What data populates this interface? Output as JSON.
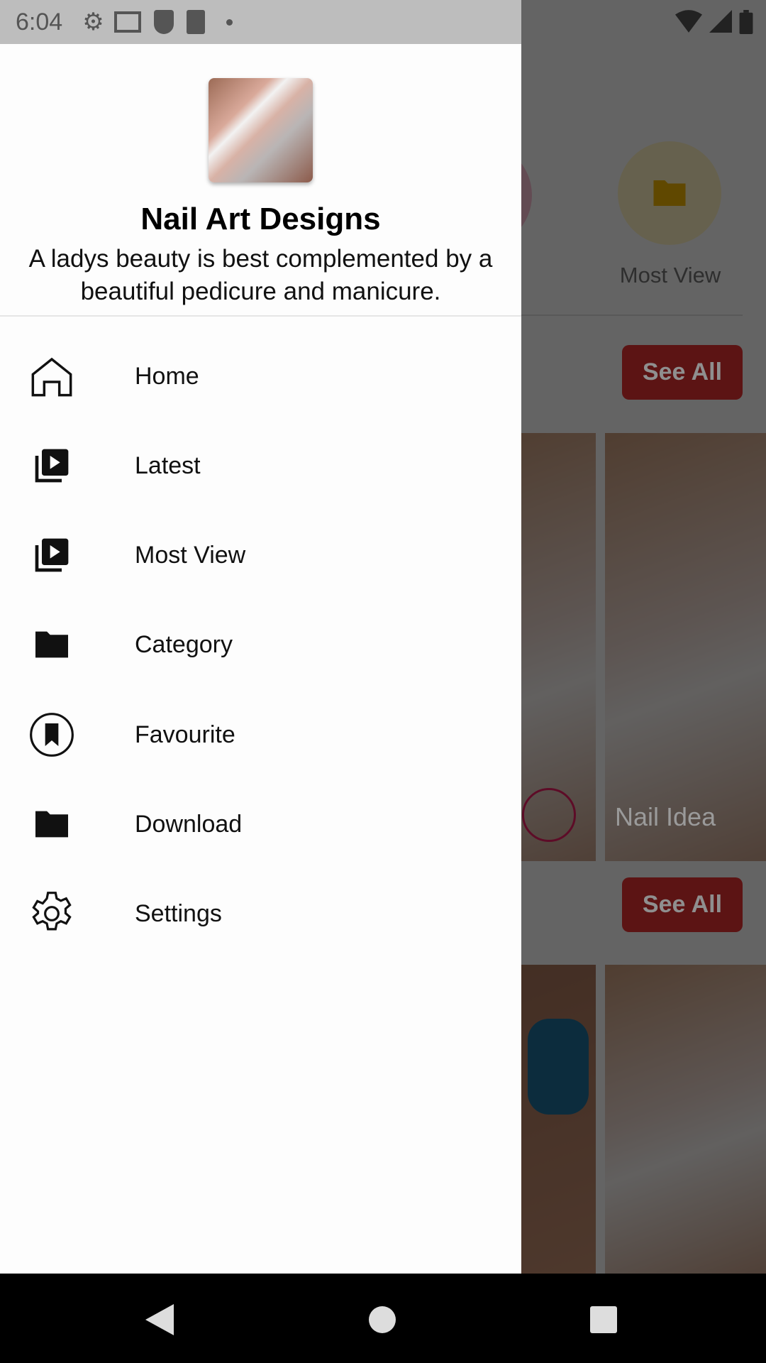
{
  "status_bar": {
    "time": "6:04"
  },
  "drawer": {
    "app_title": "Nail Art Designs",
    "description": "A ladys beauty is best complemented by a beautiful pedicure and manicure.",
    "items": [
      {
        "label": "Home",
        "icon": "home-icon"
      },
      {
        "label": "Latest",
        "icon": "video-library-icon"
      },
      {
        "label": "Most View",
        "icon": "video-library-icon"
      },
      {
        "label": "Category",
        "icon": "folder-icon"
      },
      {
        "label": "Favourite",
        "icon": "bookmark-circle-icon"
      },
      {
        "label": "Download",
        "icon": "folder-icon"
      },
      {
        "label": "Settings",
        "icon": "gear-icon"
      }
    ]
  },
  "background": {
    "most_view_label": "Most View",
    "see_all_label": "See All",
    "card_caption": "Nail Idea",
    "accent": "#d32f2f"
  }
}
